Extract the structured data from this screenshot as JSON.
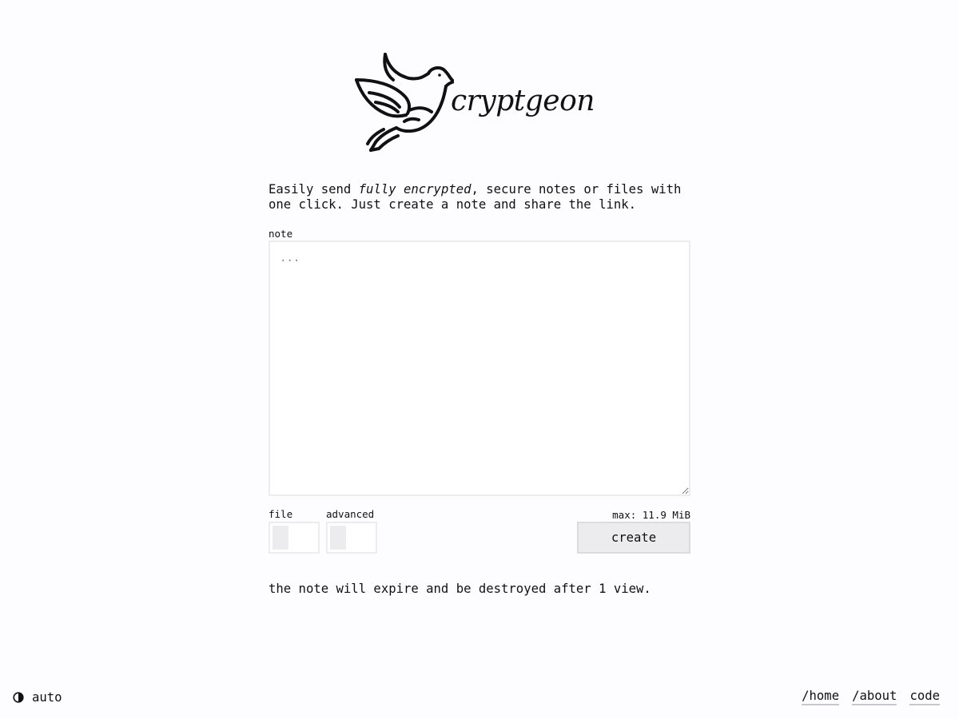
{
  "brand": {
    "name": "cryptgeon"
  },
  "intro": {
    "before": "Easily send ",
    "emphasis": "fully encrypted",
    "after": ", secure notes or files with one click. Just create a note and share the link."
  },
  "form": {
    "note_label": "note",
    "note_placeholder": "...",
    "note_value": "",
    "file_label": "file",
    "file_enabled": false,
    "advanced_label": "advanced",
    "advanced_enabled": false,
    "max_label": "max: 11.9 MiB",
    "create_label": "create"
  },
  "expiry_text": "the note will expire and be destroyed after 1 view.",
  "footer": {
    "theme_label": "auto",
    "theme_icon": "half-circle-contrast-icon",
    "links": [
      {
        "label": "/home"
      },
      {
        "label": "/about"
      },
      {
        "label": "code"
      }
    ]
  },
  "colors": {
    "background": "#fdfcfe",
    "text": "#111111",
    "border": "#ececee",
    "button_bg": "#ececee"
  }
}
